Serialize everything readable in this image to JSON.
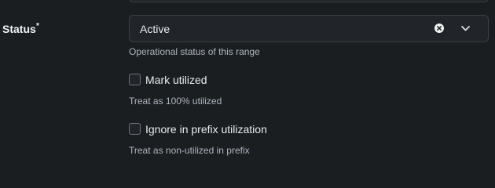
{
  "field": {
    "label": "Status",
    "required_mark": "*",
    "select": {
      "value": "Active",
      "clear_icon": "x-circle-icon",
      "dropdown_icon": "chevron-down-icon"
    },
    "help_text": "Operational status of this range"
  },
  "checkboxes": [
    {
      "label": "Mark utilized",
      "checked": false,
      "help_text": "Treat as 100% utilized"
    },
    {
      "label": "Ignore in prefix utilization",
      "checked": false,
      "help_text": "Treat as non-utilized in prefix"
    }
  ]
}
